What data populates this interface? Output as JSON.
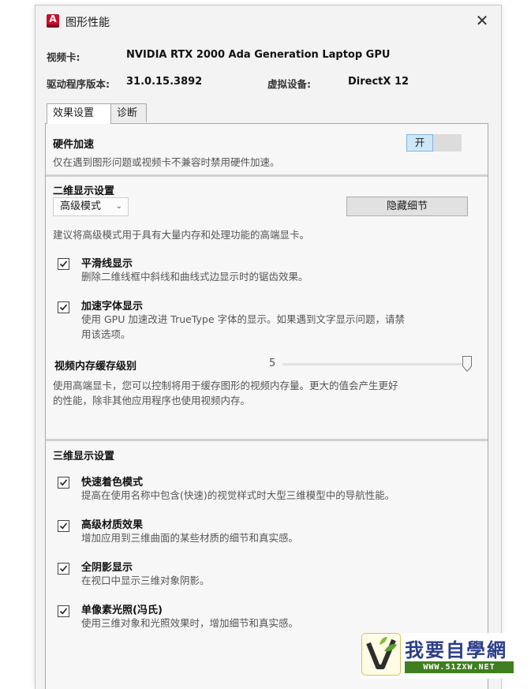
{
  "window": {
    "title": "图形性能",
    "close_glyph": "✕",
    "app_icon_letter": "A"
  },
  "info": {
    "gpu_label": "视频卡:",
    "gpu_value": "NVIDIA RTX 2000 Ada Generation Laptop GPU",
    "driver_label": "驱动程序版本:",
    "driver_value": "31.0.15.3892",
    "virtual_label": "虚拟设备:",
    "virtual_value": "DirectX 12"
  },
  "tabs": [
    {
      "label": "效果设置",
      "active": true
    },
    {
      "label": "诊断",
      "active": false
    }
  ],
  "hardware": {
    "title": "硬件加速",
    "desc": "仅在遇到图形问题或视频卡不兼容时禁用硬件加速。",
    "toggle_label": "开",
    "toggle_on": true
  },
  "display2d": {
    "title": "二维显示设置",
    "mode_value": "高级模式",
    "hide_details_label": "隐藏细节",
    "desc": "建议将高级模式用于具有大量内存和处理功能的高端显卡。",
    "options": [
      {
        "label": "平滑线显示",
        "desc": "删除二维线框中斜线和曲线式边显示时的锯齿效果。",
        "checked": true
      },
      {
        "label": "加速字体显示",
        "desc": "使用 GPU 加速改进 TrueType 字体的显示。如果遇到文字显示问题，请禁",
        "desc2": "用该选项。",
        "checked": true
      }
    ],
    "cache_label": "视频内存缓存级别",
    "cache_value": "5",
    "cache_level_fraction": 1.0,
    "cache_desc": "使用高端显卡，您可以控制将用于缓存图形的视频内存量。更大的值会产生更好",
    "cache_desc2": "的性能，除非其他应用程序也使用视频内存。"
  },
  "display3d": {
    "title": "三维显示设置",
    "options": [
      {
        "label": "快速着色模式",
        "desc": "提高在使用名称中包含(快速)的视觉样式时大型三维模型中的导航性能。",
        "checked": true
      },
      {
        "label": "高级材质效果",
        "desc": "增加应用到三维曲面的某些材质的细节和真实感。",
        "checked": true
      },
      {
        "label": "全阴影显示",
        "desc": "在视口中显示三维对象阴影。",
        "checked": true
      },
      {
        "label": "单像素光照(冯氏)",
        "desc": "使用三维对象和光照效果时，增加细节和真实感。",
        "checked": true
      }
    ]
  },
  "watermark": {
    "text": "我要自學網",
    "url": "WWW.51ZXW.NET"
  },
  "colors": {
    "toggle_on_bg": "#cfe6f7",
    "app_icon": "#c8102e",
    "watermark_url_bg": "#3f7f1f"
  }
}
